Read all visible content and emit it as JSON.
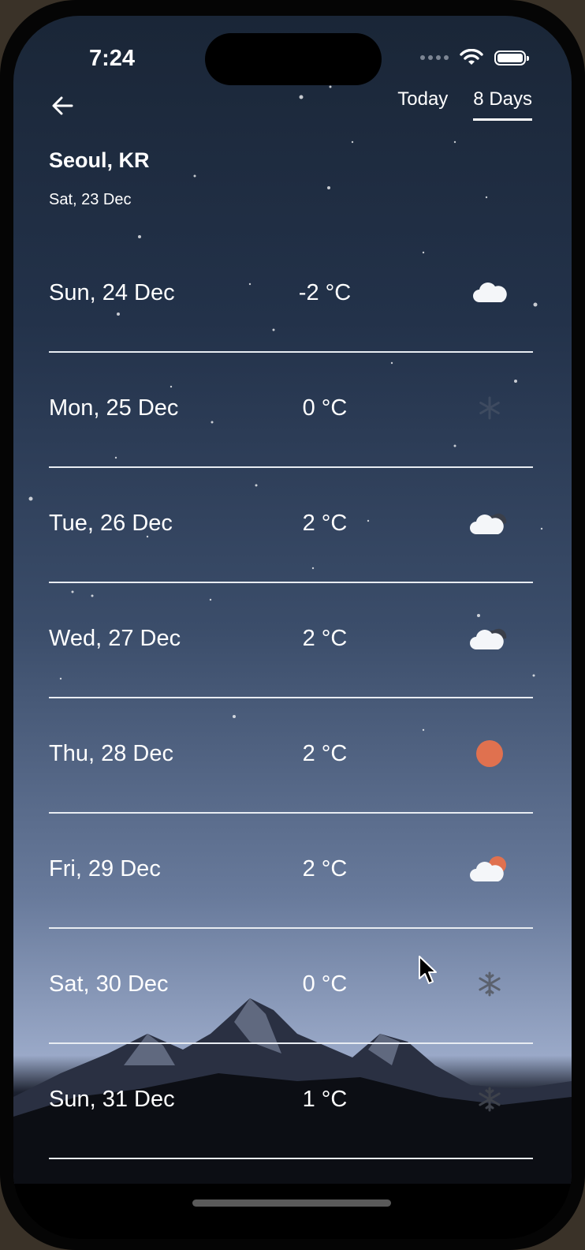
{
  "status_bar": {
    "time": "7:24",
    "icons": [
      "cellular-dots-icon",
      "wifi-icon",
      "battery-icon"
    ]
  },
  "header": {
    "back_icon": "arrow-left-icon",
    "tabs": [
      {
        "label": "Today",
        "active": false
      },
      {
        "label": "8 Days",
        "active": true
      }
    ]
  },
  "location": {
    "city": "Seoul, KR",
    "date": "Sat, 23 Dec"
  },
  "forecast": [
    {
      "day": "Sun, 24 Dec",
      "temp": "-2 °C",
      "icon": "cloud-icon"
    },
    {
      "day": "Mon, 25 Dec",
      "temp": "0 °C",
      "icon": "snowflake-icon"
    },
    {
      "day": "Tue, 26 Dec",
      "temp": "2 °C",
      "icon": "cloudy-icon"
    },
    {
      "day": "Wed, 27 Dec",
      "temp": "2 °C",
      "icon": "cloudy-icon"
    },
    {
      "day": "Thu, 28 Dec",
      "temp": "2 °C",
      "icon": "sun-icon"
    },
    {
      "day": "Fri, 29 Dec",
      "temp": "2 °C",
      "icon": "partly-cloudy-icon"
    },
    {
      "day": "Sat, 30 Dec",
      "temp": "0 °C",
      "icon": "snowflake-icon"
    },
    {
      "day": "Sun, 31 Dec",
      "temp": "1 °C",
      "icon": "snowflake-icon"
    }
  ],
  "colors": {
    "sun": "#e0714f",
    "text": "#ffffff",
    "snow_icon": "#6d7380"
  }
}
